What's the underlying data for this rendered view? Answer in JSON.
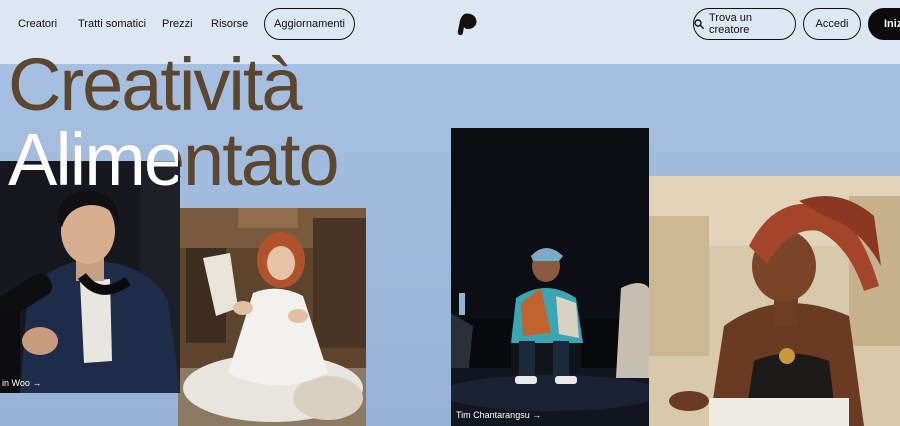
{
  "nav": {
    "items": [
      {
        "label": "Creatori"
      },
      {
        "label": "Tratti somatici"
      },
      {
        "label": "Prezzi"
      },
      {
        "label": "Risorse"
      }
    ],
    "updates_label": "Aggiornamenti"
  },
  "header": {
    "logo_icon": "patreon-logo-icon",
    "search_label": "Trova un creatore",
    "search_icon": "search-icon",
    "login_label": "Accedi",
    "start_label": "Inizi"
  },
  "hero": {
    "line1": "Creatività",
    "line2": "Alimentato"
  },
  "cards": [
    {
      "caption": "in Woo →"
    },
    {
      "caption": ""
    },
    {
      "caption": "Tim Chantarangsu →"
    },
    {
      "caption": ""
    }
  ],
  "colors": {
    "header_bg": "#dce7f3",
    "page_bg": "#a9c2e3",
    "title": "#5b4630",
    "button_dark": "#0b0b0b"
  }
}
